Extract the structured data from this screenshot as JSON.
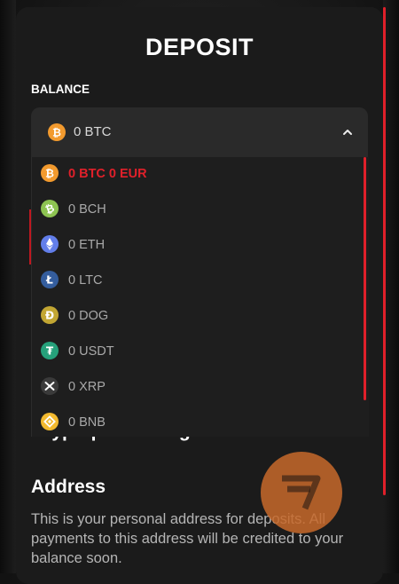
{
  "modal": {
    "title": "DEPOSIT",
    "balance_label": "BALANCE",
    "selected": {
      "text": "0 BTC",
      "icon": "bitcoin-icon"
    }
  },
  "dropdown": {
    "items": [
      {
        "text": "0 BTC 0 EUR",
        "icon": "bitcoin-icon",
        "color": "#f29a2e",
        "active": true
      },
      {
        "text": "0 BCH",
        "icon": "bitcoin-cash-icon",
        "color": "#8dc351"
      },
      {
        "text": "0 ETH",
        "icon": "ethereum-icon",
        "color": "#627eea"
      },
      {
        "text": "0 LTC",
        "icon": "litecoin-icon",
        "color": "#345d9d"
      },
      {
        "text": "0 DOG",
        "icon": "dogecoin-icon",
        "color": "#c2a633"
      },
      {
        "text": "0 USDT",
        "icon": "tether-icon",
        "color": "#26a17b"
      },
      {
        "text": "0 XRP",
        "icon": "ripple-icon",
        "color": "#3a3a3a"
      },
      {
        "text": "0 BNB",
        "icon": "binance-icon",
        "color": "#f3ba2f"
      }
    ]
  },
  "content": {
    "section_title": "Cryptoprocessing",
    "address_title": "Address",
    "address_desc": "This is your personal address for deposits. All payments to this address will be credited to your balance soon."
  },
  "colors": {
    "accent": "#e0202a",
    "modal_bg": "#1b1b1b",
    "select_bg": "#2a2a2a",
    "logo": "#c7692b"
  }
}
